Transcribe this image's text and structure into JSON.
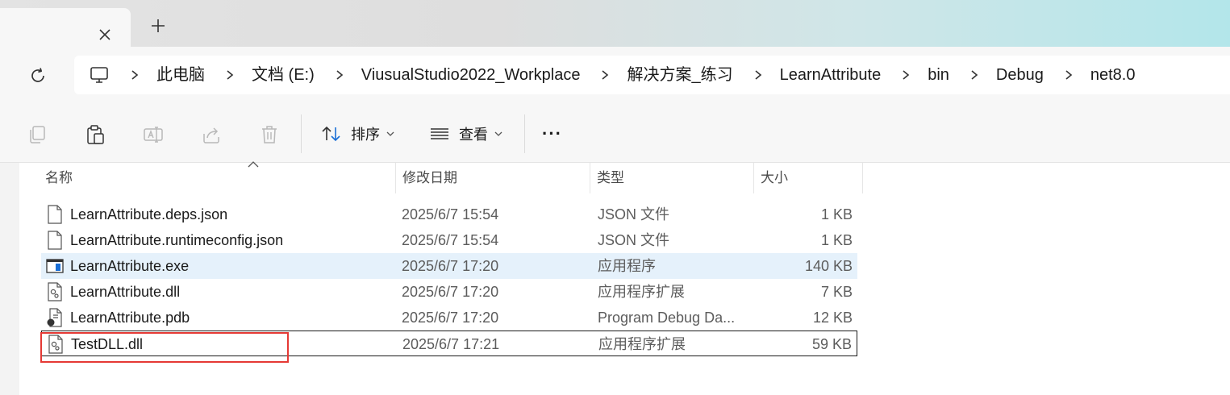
{
  "tabs": {
    "close_icon": "close-icon",
    "new_tab_icon": "plus-icon"
  },
  "address": {
    "root_icon": "computer-icon",
    "crumbs": [
      "此电脑",
      "文档 (E:)",
      "ViusualStudio2022_Workplace",
      "解决方案_练习",
      "LearnAttribute",
      "bin",
      "Debug",
      "net8.0"
    ]
  },
  "toolbar": {
    "sort_label": "排序",
    "view_label": "查看",
    "more_label": "···"
  },
  "columns": {
    "name": "名称",
    "date": "修改日期",
    "type": "类型",
    "size": "大小"
  },
  "files": [
    {
      "name": "LearnAttribute.deps.json",
      "date": "2025/6/7 15:54",
      "type": "JSON 文件",
      "size": "1 KB",
      "icon": "json-file-icon"
    },
    {
      "name": "LearnAttribute.runtimeconfig.json",
      "date": "2025/6/7 15:54",
      "type": "JSON 文件",
      "size": "1 KB",
      "icon": "json-file-icon"
    },
    {
      "name": "LearnAttribute.exe",
      "date": "2025/6/7 17:20",
      "type": "应用程序",
      "size": "140 KB",
      "icon": "exe-file-icon"
    },
    {
      "name": "LearnAttribute.dll",
      "date": "2025/6/7 17:20",
      "type": "应用程序扩展",
      "size": "7 KB",
      "icon": "dll-file-icon"
    },
    {
      "name": "LearnAttribute.pdb",
      "date": "2025/6/7 17:20",
      "type": "Program Debug Da...",
      "size": "12 KB",
      "icon": "pdb-file-icon"
    },
    {
      "name": "TestDLL.dll",
      "date": "2025/6/7 17:21",
      "type": "应用程序扩展",
      "size": "59 KB",
      "icon": "dll-file-icon"
    }
  ],
  "colors": {
    "selected_row": "#e5f1fb",
    "highlight_box": "#e53935"
  }
}
